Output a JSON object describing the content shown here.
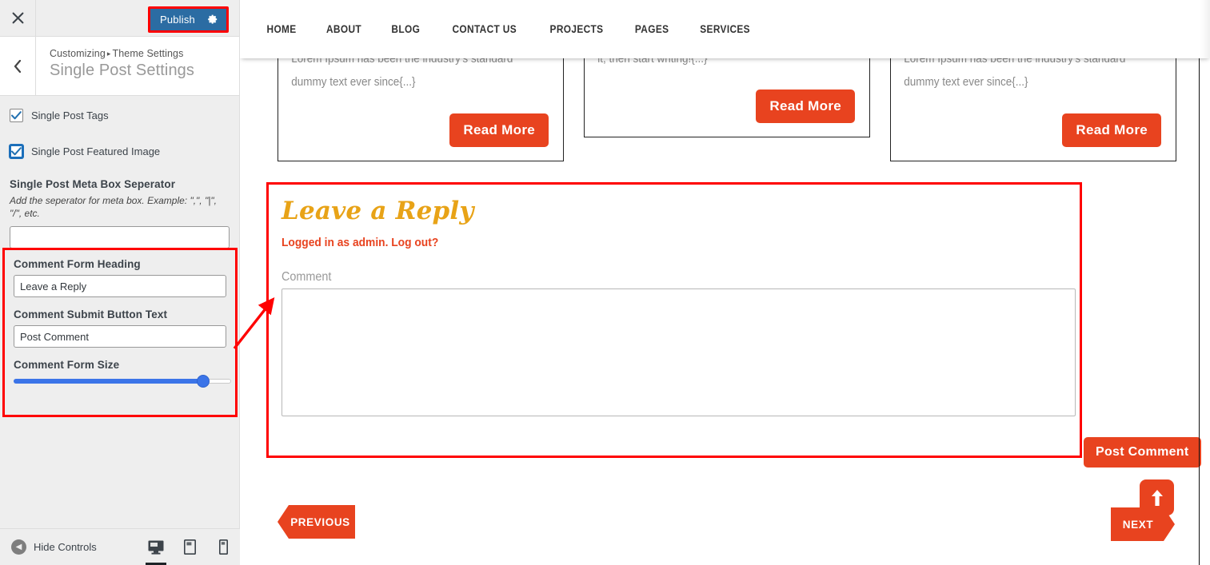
{
  "customizer": {
    "topbar": {
      "close_icon": "close-icon",
      "publish_label": "Publish",
      "gear_icon": "gear-icon"
    },
    "header": {
      "back_icon": "chevron-left-icon",
      "breadcrumb_root": "Customizing",
      "breadcrumb_sep": "▸",
      "breadcrumb_parent": "Theme Settings",
      "panel_title": "Single Post Settings"
    },
    "controls": {
      "checkboxes": [
        {
          "label": "Single Post Tags",
          "checked": true
        },
        {
          "label": "Single Post Featured Image",
          "checked": true
        }
      ],
      "separator": {
        "title": "Single Post Meta Box Seperator",
        "description": "Add the seperator for meta box. Example: \",\", \"|\", \"/\", etc.",
        "value": "",
        "placeholder": ""
      },
      "comment_form_heading": {
        "title": "Comment Form Heading",
        "value": "Leave a Reply"
      },
      "comment_submit_button_text": {
        "title": "Comment Submit Button Text",
        "value": "Post Comment"
      },
      "comment_form_size": {
        "title": "Comment Form Size",
        "value": 87,
        "min": 0,
        "max": 100
      }
    },
    "footer": {
      "hide_controls_label": "Hide Controls",
      "hide_controls_icon": "collapse-left-icon",
      "devices": [
        {
          "name": "desktop",
          "icon": "desktop-icon",
          "active": true
        },
        {
          "name": "tablet",
          "icon": "tablet-icon",
          "active": false
        },
        {
          "name": "mobile",
          "icon": "mobile-icon",
          "active": false
        }
      ]
    }
  },
  "preview": {
    "nav": [
      {
        "label": "HOME"
      },
      {
        "label": "ABOUT"
      },
      {
        "label": "BLOG"
      },
      {
        "label": "CONTACT US"
      },
      {
        "label": "PROJECTS"
      },
      {
        "label": "PAGES"
      },
      {
        "label": "SERVICES"
      }
    ],
    "cards": [
      {
        "excerpt": "Lorem Ipsum has been the industry's standard dummy text ever since{...}",
        "button": "Read More"
      },
      {
        "excerpt": "it, then start writing!{...}",
        "button": "Read More"
      },
      {
        "excerpt": "Lorem Ipsum has been the industry's standard dummy text ever since{...}",
        "button": "Read More"
      }
    ],
    "comment_form": {
      "heading": "Leave a Reply",
      "logged_in_prefix": "Logged in as admin. ",
      "logout_link": "Log out?",
      "comment_label": "Comment",
      "comment_value": "",
      "submit_label": "Post Comment"
    },
    "pagination": {
      "previous": "PREVIOUS",
      "next": "NEXT"
    },
    "scroll_top_icon": "arrow-up-icon"
  },
  "colors": {
    "accent_orange": "#e8431f",
    "gold_heading": "#e8a317",
    "publish_blue": "#2b6ca3",
    "annotation_red": "#ff0000",
    "slider_blue": "#3b74e8"
  }
}
